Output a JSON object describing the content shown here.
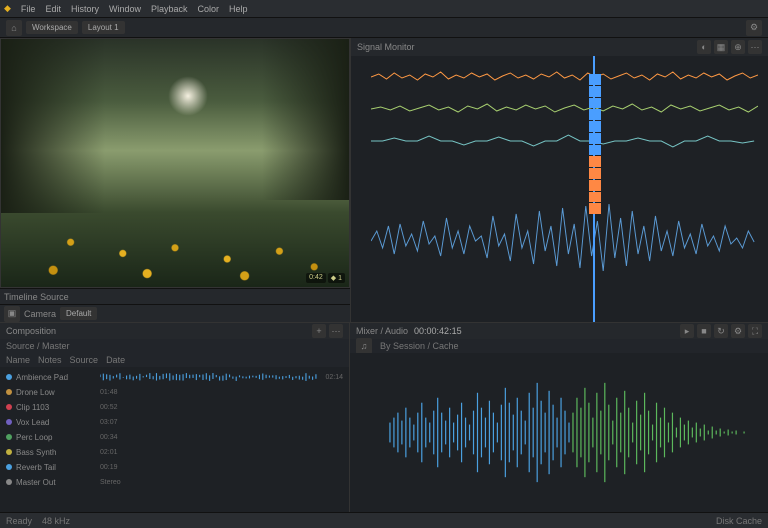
{
  "menubar": [
    "File",
    "Edit",
    "History",
    "Window",
    "Playback",
    "Color",
    "Help"
  ],
  "toolbar": {
    "tabs": [
      "Workspace",
      "Layout 1"
    ]
  },
  "preview": {
    "timecode": "0:42",
    "marker": "◆ 1",
    "label": "Timeline Source"
  },
  "under_preview": {
    "label": "Camera",
    "chip": "Default"
  },
  "scopes": {
    "title": "Signal Monitor",
    "tracks": [
      {
        "color": "#ff9944"
      },
      {
        "color": "#a8d070"
      },
      {
        "color": "#77c5c5"
      },
      {
        "color": "#5b9bd5"
      }
    ]
  },
  "composition": {
    "title": "Composition",
    "subtitle": "Source / Master",
    "mode_tabs": [
      "Name",
      "Notes",
      "Source",
      "Date"
    ],
    "tracks": [
      {
        "dot": "#4aa0e0",
        "label": "Ambience Pad",
        "meta": "02:14"
      },
      {
        "dot": "#c09040",
        "label": "Drone Low",
        "meta": "01:48"
      },
      {
        "dot": "#d04050",
        "label": "Clip 1103",
        "meta": "00:52"
      },
      {
        "dot": "#7060c0",
        "label": "Vox Lead",
        "meta": "03:07"
      },
      {
        "dot": "#50a060",
        "label": "Perc Loop",
        "meta": "00:34"
      },
      {
        "dot": "#c0b040",
        "label": "Bass Synth",
        "meta": "02:01"
      },
      {
        "dot": "#4aa0e0",
        "label": "Reverb Tail",
        "meta": "00:19"
      },
      {
        "dot": "#888",
        "label": "Master Out",
        "meta": "Stereo"
      }
    ]
  },
  "editor": {
    "title": "Mixer / Audio",
    "timecode": "00:00:42:15",
    "sub": "By Session / Cache"
  },
  "status": {
    "left": "Ready",
    "mid": "48 kHz",
    "right": "Disk Cache"
  }
}
